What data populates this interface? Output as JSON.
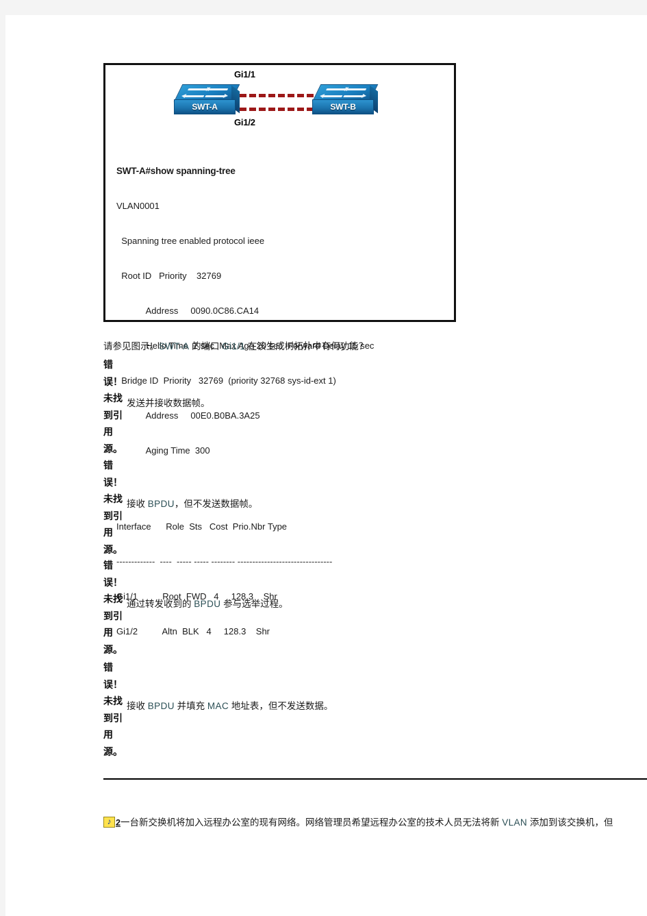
{
  "document": {
    "page_background": "#ffffff",
    "margin_color": "#f4f4f4"
  },
  "exhibit": {
    "name": "spanning-tree-exhibit",
    "topology": {
      "port_label_top": "Gi1/1",
      "port_label_bottom": "Gi1/2",
      "switch_left": "SWT-A",
      "switch_right": "SWT-B",
      "link_color": "#9c1818",
      "switch_color": "#1b7fc0"
    },
    "cli": {
      "prompt": "SWT-A#show spanning-tree",
      "lines": [
        "VLAN0001",
        "  Spanning tree enabled protocol ieee",
        "  Root ID   Priority    32769",
        "            Address     0090.0C86.CA14",
        "            Hello Time  2 sec  Max Age 20 sec  Forward Delay 15 sec",
        "  Bridge ID  Priority   32769  (priority 32768 sys-id-ext 1)",
        "            Address     00E0.B0BA.3A25",
        "            Aging Time  300"
      ],
      "table": {
        "header": "Interface      Role  Sts   Cost  Prio.Nbr Type",
        "rule": "-------------  ----  ----- ----- -------- --------------------------------",
        "rows": [
          "Gi1/1          Root  FWD   4     128.3    Shr",
          "Gi1/2          Altn  BLK   4     128.3    Shr"
        ]
      }
    }
  },
  "question": {
    "prefix": "请参见图示。",
    "subject": "SWT-A",
    "middle": " 的端口 ",
    "port": "Gi1/1",
    "suffix": " 在该生成树拓扑中有何功能？",
    "full_text": "请参见图示。SWT-A 的端口 Gi1/1 在该生成树拓扑中有何功能？"
  },
  "broken_reference_text": "错误！未找到引用源。",
  "options": [
    {
      "id": "option-a",
      "text": "发送并接收数据帧。"
    },
    {
      "id": "option-b",
      "pre": "接收 ",
      "code": "BPDU",
      "post": "，但不发送数据帧。"
    },
    {
      "id": "option-c",
      "pre": "通过转发收到的 ",
      "code": "BPDU",
      "post": " 参与选举过程。"
    },
    {
      "id": "option-d",
      "pre": "接收 ",
      "code": "BPDU",
      "mid": " 并填充 ",
      "code2": "MAC",
      "post": " 地址表，但不发送数据。"
    }
  ],
  "next_question": {
    "icon": "anchor-bookmark-icon",
    "number": "2",
    "text": "一台新交换机将加入远程办公室的现有网络。网络管理员希望远程办公室的技术人员无法将新 ",
    "code": "VLAN",
    "text2": " 添加到该交换机，但"
  }
}
